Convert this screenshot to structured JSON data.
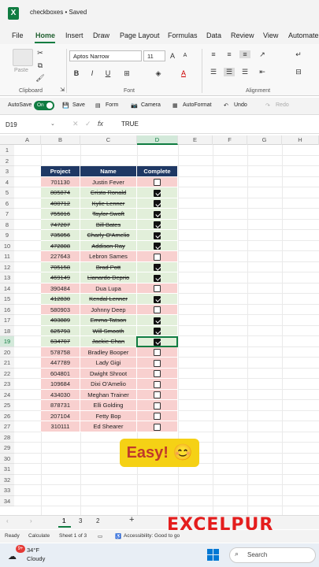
{
  "app": {
    "title": "checkboxes • Saved",
    "logo_letter": "X"
  },
  "tabs": [
    "File",
    "Home",
    "Insert",
    "Draw",
    "Page Layout",
    "Formulas",
    "Data",
    "Review",
    "View",
    "Automate"
  ],
  "active_tab": "Home",
  "ribbon": {
    "paste_label": "Paste",
    "clipboard_label": "Clipboard",
    "font_label": "Font",
    "alignment_label": "Alignment",
    "font_name": "Aptos Narrow",
    "font_size": "11",
    "bold": "B",
    "italic": "I",
    "underline": "U",
    "grow": "A",
    "shrink": "A"
  },
  "quick_access": {
    "autosave_label": "AutoSave",
    "autosave_state": "On",
    "save": "Save",
    "form": "Form",
    "camera": "Camera",
    "autoformat": "AutoFormat",
    "undo": "Undo",
    "redo": "Redo"
  },
  "formula_bar": {
    "name_box": "D19",
    "fx": "fx",
    "value": "TRUE"
  },
  "columns": [
    "A",
    "B",
    "C",
    "D",
    "E",
    "F",
    "G",
    "H"
  ],
  "selected_column": "D",
  "rows": [
    "1",
    "2",
    "3",
    "4",
    "5",
    "6",
    "7",
    "8",
    "9",
    "10",
    "11",
    "12",
    "13",
    "14",
    "15",
    "16",
    "17",
    "18",
    "19",
    "20",
    "21",
    "22",
    "23",
    "24",
    "25",
    "26",
    "27",
    "28",
    "29",
    "30",
    "31",
    "32",
    "33",
    "34"
  ],
  "selected_row": "19",
  "table": {
    "headers": {
      "project": "Project",
      "name": "Name",
      "complete": "Complete"
    },
    "rows": [
      {
        "project": "701130",
        "name": "Justin Fever",
        "complete": false
      },
      {
        "project": "805874",
        "name": "Cristo Ronald",
        "complete": true
      },
      {
        "project": "400712",
        "name": "Kylie Lenner",
        "complete": true
      },
      {
        "project": "755016",
        "name": "Taylor Swoft",
        "complete": true
      },
      {
        "project": "747207",
        "name": "Bill Bates",
        "complete": true
      },
      {
        "project": "735056",
        "name": "Charly O'Amelio",
        "complete": true
      },
      {
        "project": "472808",
        "name": "Addison Ray",
        "complete": true
      },
      {
        "project": "227643",
        "name": "Lebron Sames",
        "complete": false
      },
      {
        "project": "705158",
        "name": "Brad Pott",
        "complete": true
      },
      {
        "project": "469149",
        "name": "Lianardo Deprio",
        "complete": true
      },
      {
        "project": "390484",
        "name": "Dua Lupa",
        "complete": false
      },
      {
        "project": "412830",
        "name": "Kendal Lenner",
        "complete": true
      },
      {
        "project": "580903",
        "name": "Johnny Deep",
        "complete": false
      },
      {
        "project": "403889",
        "name": "Emma Tatson",
        "complete": true
      },
      {
        "project": "625793",
        "name": "Will Smooth",
        "complete": true
      },
      {
        "project": "634707",
        "name": "Jackie Chan",
        "complete": true
      },
      {
        "project": "578758",
        "name": "Bradley Booper",
        "complete": false
      },
      {
        "project": "447789",
        "name": "Lady Gigi",
        "complete": false
      },
      {
        "project": "604801",
        "name": "Dwight Shroot",
        "complete": false
      },
      {
        "project": "109684",
        "name": "Dixi O'Amelio",
        "complete": false
      },
      {
        "project": "434030",
        "name": "Meghan Trainer",
        "complete": false
      },
      {
        "project": "878731",
        "name": "Elli Golding",
        "complete": false
      },
      {
        "project": "207104",
        "name": "Fetty Bop",
        "complete": false
      },
      {
        "project": "310111",
        "name": "Ed Shearer",
        "complete": false
      }
    ]
  },
  "overlay_caption": "Easy! 😊",
  "sheet_tabs": [
    "1",
    "3",
    "2"
  ],
  "active_sheet": "1",
  "brand": "EXCELPUR",
  "status": {
    "ready": "Ready",
    "calculate": "Calculate",
    "sheet_info": "Sheet 1 of 3",
    "accessibility": "Accessibility: Good to go"
  },
  "taskbar": {
    "temperature": "34°F",
    "condition": "Cloudy",
    "badge": "9+",
    "search": "Search"
  },
  "colors": {
    "accent": "#107c41",
    "header_bg": "#1f3864",
    "done_bg": "#e2efda",
    "todo_bg": "#f8d0cf",
    "caption_bg": "#f5d115",
    "brand": "#e41d1d"
  }
}
